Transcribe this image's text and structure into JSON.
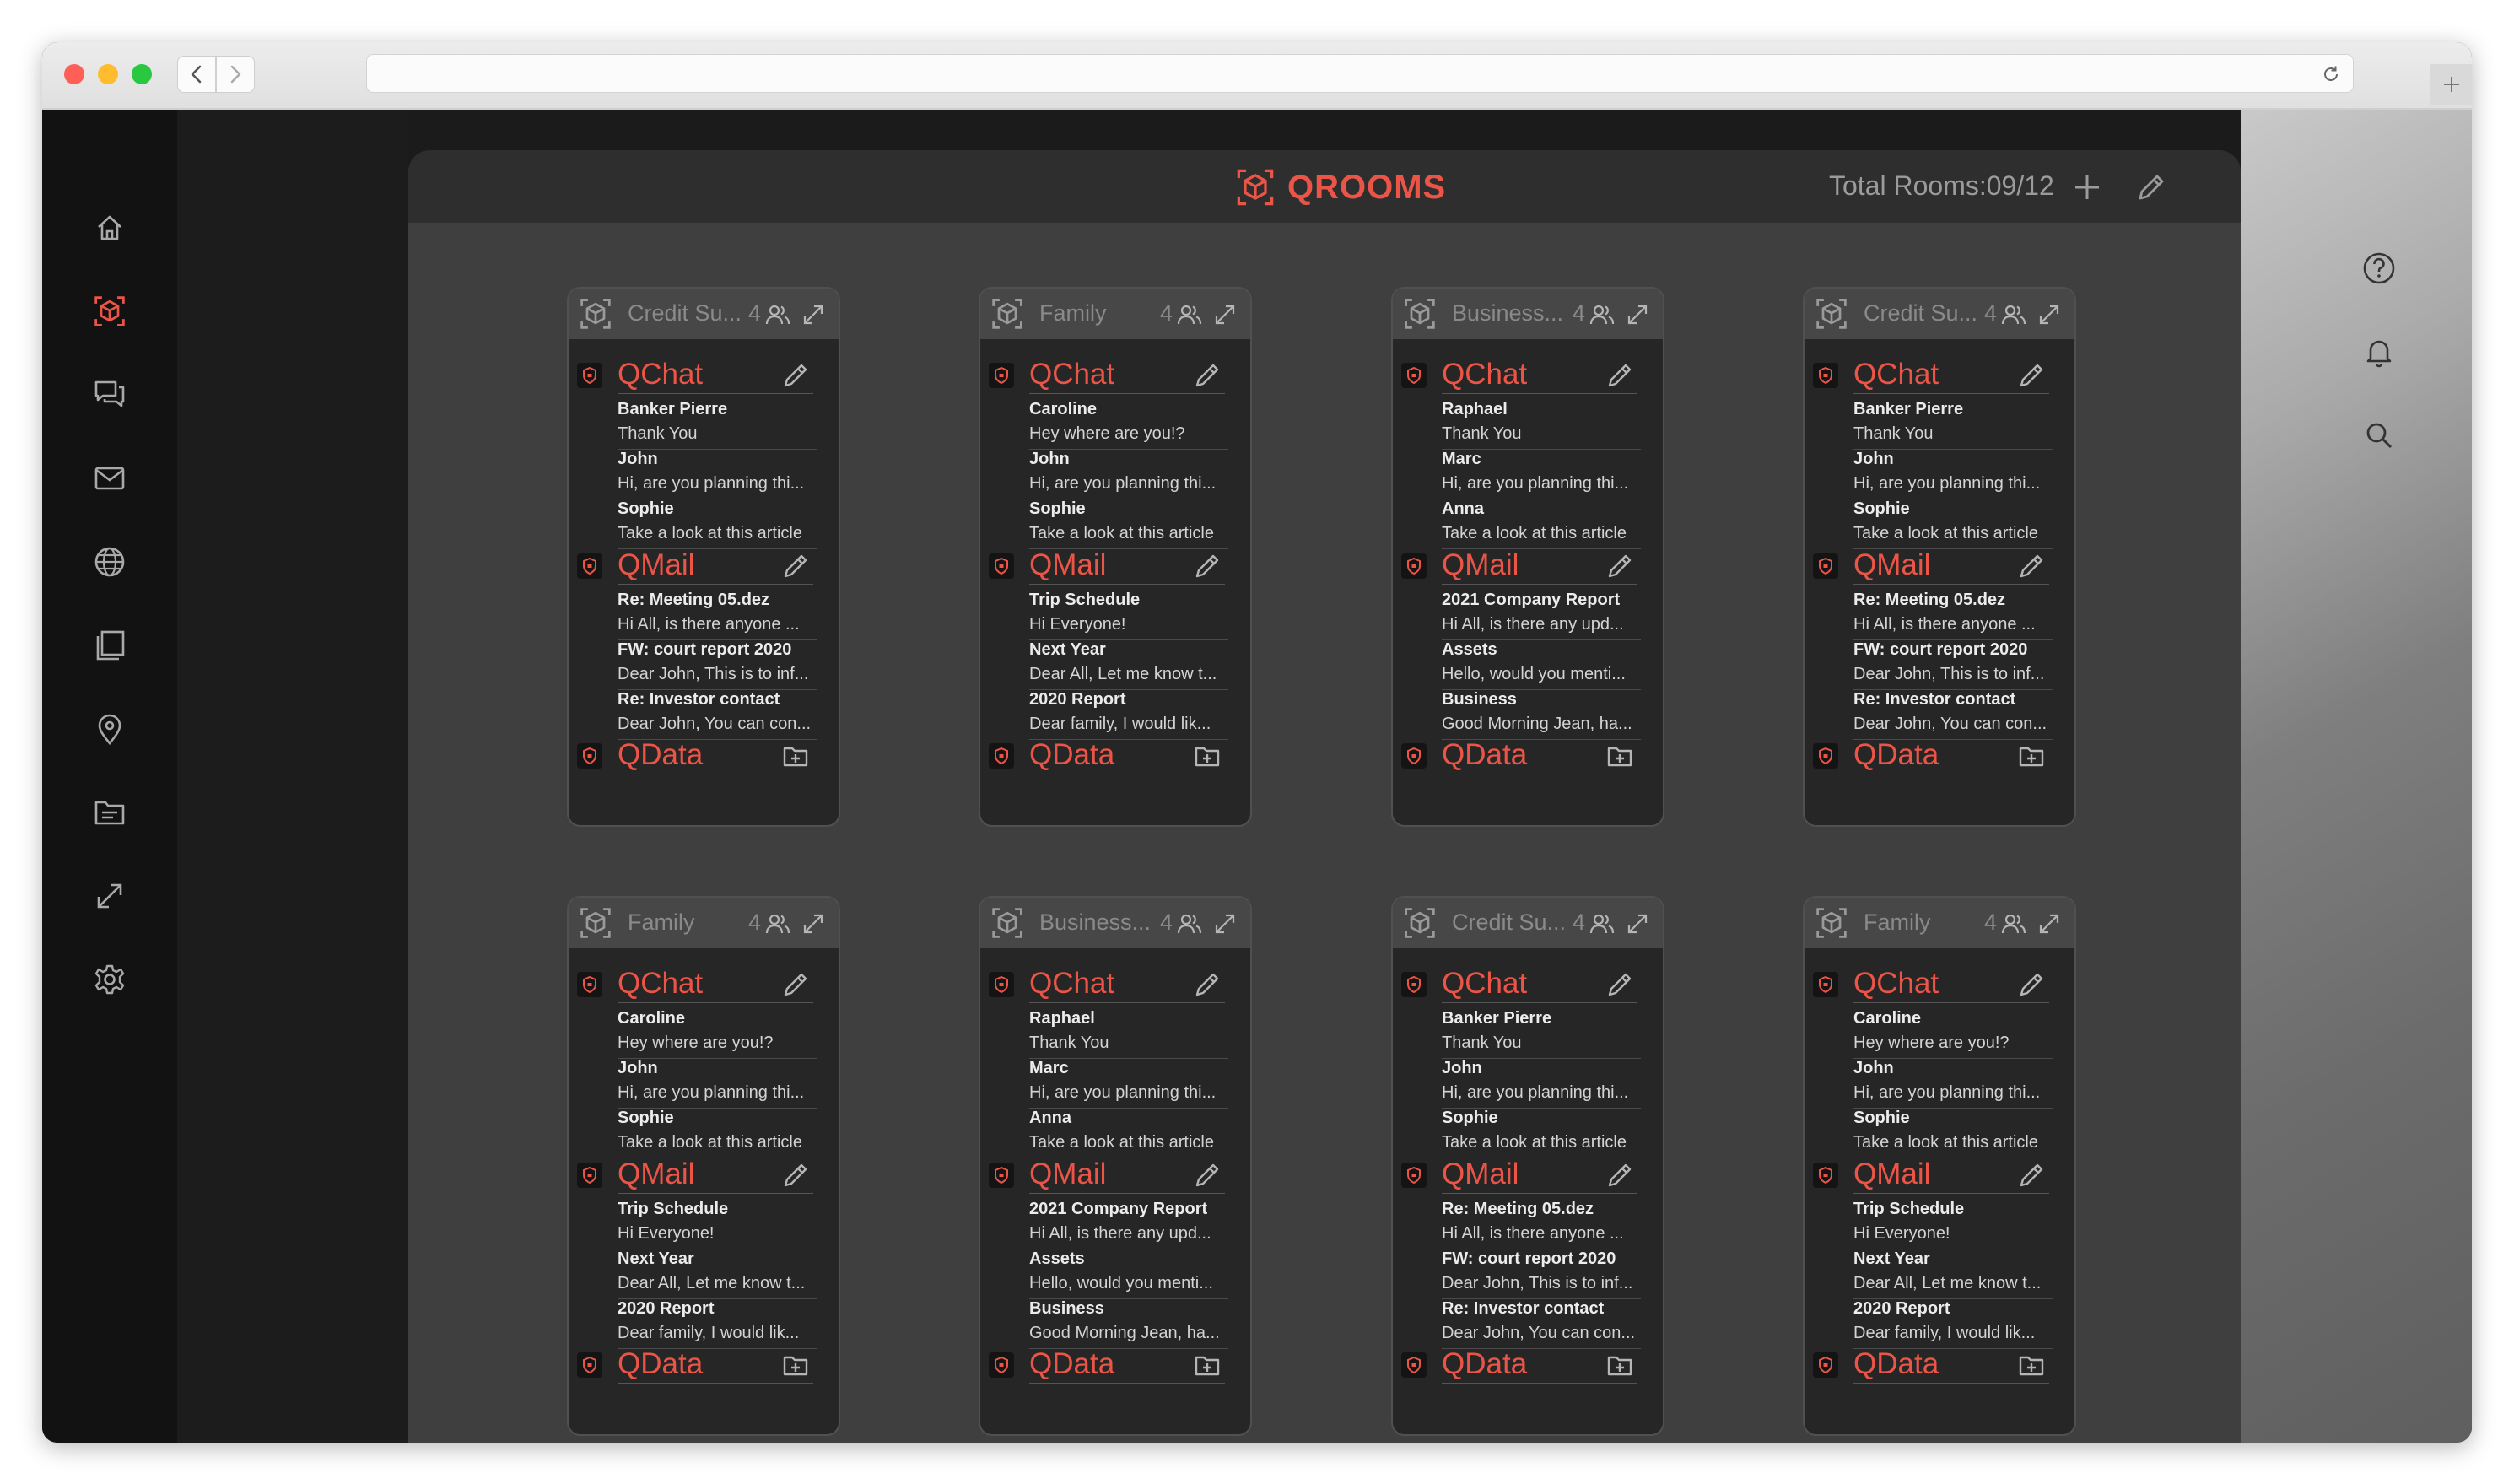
{
  "app": {
    "brand": "QROOMS",
    "total_rooms_label": "Total Rooms:09/12",
    "accent": "#ea5547",
    "icon_color": "#a9a9a9"
  },
  "sidebar": {
    "items": [
      {
        "icon": "home-icon"
      },
      {
        "icon": "rooms-cube-icon",
        "active": true
      },
      {
        "icon": "chat-bubbles-icon"
      },
      {
        "icon": "mail-icon"
      },
      {
        "icon": "globe-icon"
      },
      {
        "icon": "pages-icon"
      },
      {
        "icon": "location-pin-icon"
      },
      {
        "icon": "folder-icon"
      },
      {
        "icon": "expand-arrow-icon"
      },
      {
        "icon": "settings-gear-icon"
      }
    ]
  },
  "right_toolbar": {
    "items": [
      {
        "icon": "help-icon"
      },
      {
        "icon": "bell-icon"
      },
      {
        "icon": "search-icon"
      }
    ]
  },
  "sections": {
    "chat": "QChat",
    "mail": "QMail",
    "data": "QData"
  },
  "rooms": [
    {
      "title": "Credit Su...",
      "count": "4",
      "chat": [
        {
          "who": "Banker Pierre",
          "text": "Thank You"
        },
        {
          "who": "John",
          "text": "Hi, are you planning thi..."
        },
        {
          "who": "Sophie",
          "text": "Take a look at this article"
        }
      ],
      "mail": [
        {
          "who": "Re: Meeting 05.dez",
          "text": "Hi All, is there anyone ..."
        },
        {
          "who": "FW: court report 2020",
          "text": "Dear John, This is to inf..."
        },
        {
          "who": "Re: Investor contact",
          "text": "Dear John, You can con..."
        }
      ]
    },
    {
      "title": "Family",
      "count": "4",
      "chat": [
        {
          "who": "Caroline",
          "text": "Hey where are you!?"
        },
        {
          "who": "John",
          "text": "Hi, are you planning thi..."
        },
        {
          "who": "Sophie",
          "text": "Take a look at this article"
        }
      ],
      "mail": [
        {
          "who": "Trip Schedule",
          "text": "Hi Everyone!"
        },
        {
          "who": "Next Year",
          "text": "Dear All, Let me know t..."
        },
        {
          "who": "2020 Report",
          "text": "Dear family, I would lik..."
        }
      ]
    },
    {
      "title": "Business...",
      "count": "4",
      "chat": [
        {
          "who": "Raphael",
          "text": "Thank You"
        },
        {
          "who": "Marc",
          "text": "Hi, are you planning thi..."
        },
        {
          "who": "Anna",
          "text": "Take a look at this article"
        }
      ],
      "mail": [
        {
          "who": "2021 Company Report",
          "text": "Hi All, is there any upd..."
        },
        {
          "who": "Assets",
          "text": "Hello, would you menti..."
        },
        {
          "who": "Business",
          "text": "Good Morning Jean, ha..."
        }
      ]
    },
    {
      "title": "Credit Su...",
      "count": "4",
      "chat": [
        {
          "who": "Banker Pierre",
          "text": "Thank You"
        },
        {
          "who": "John",
          "text": "Hi, are you planning thi..."
        },
        {
          "who": "Sophie",
          "text": "Take a look at this article"
        }
      ],
      "mail": [
        {
          "who": "Re: Meeting 05.dez",
          "text": "Hi All, is there anyone ..."
        },
        {
          "who": "FW: court report 2020",
          "text": "Dear John, This is to inf..."
        },
        {
          "who": "Re: Investor contact",
          "text": "Dear John, You can con..."
        }
      ]
    },
    {
      "title": "Family",
      "count": "4",
      "chat": [
        {
          "who": "Caroline",
          "text": "Hey where are you!?"
        },
        {
          "who": "John",
          "text": "Hi, are you planning thi..."
        },
        {
          "who": "Sophie",
          "text": "Take a look at this article"
        }
      ],
      "mail": [
        {
          "who": "Trip Schedule",
          "text": "Hi Everyone!"
        },
        {
          "who": "Next Year",
          "text": "Dear All, Let me know t..."
        },
        {
          "who": "2020 Report",
          "text": "Dear family, I would lik..."
        }
      ]
    },
    {
      "title": "Business...",
      "count": "4",
      "chat": [
        {
          "who": "Raphael",
          "text": "Thank You"
        },
        {
          "who": "Marc",
          "text": "Hi, are you planning thi..."
        },
        {
          "who": "Anna",
          "text": "Take a look at this article"
        }
      ],
      "mail": [
        {
          "who": "2021 Company Report",
          "text": "Hi All, is there any upd..."
        },
        {
          "who": "Assets",
          "text": "Hello, would you menti..."
        },
        {
          "who": "Business",
          "text": "Good Morning Jean, ha..."
        }
      ]
    },
    {
      "title": "Credit Su...",
      "count": "4",
      "chat": [
        {
          "who": "Banker Pierre",
          "text": "Thank You"
        },
        {
          "who": "John",
          "text": "Hi, are you planning thi..."
        },
        {
          "who": "Sophie",
          "text": "Take a look at this article"
        }
      ],
      "mail": [
        {
          "who": "Re: Meeting 05.dez",
          "text": "Hi All, is there anyone ..."
        },
        {
          "who": "FW: court report 2020",
          "text": "Dear John, This is to inf..."
        },
        {
          "who": "Re: Investor contact",
          "text": "Dear John, You can con..."
        }
      ]
    },
    {
      "title": "Family",
      "count": "4",
      "chat": [
        {
          "who": "Caroline",
          "text": "Hey where are you!?"
        },
        {
          "who": "John",
          "text": "Hi, are you planning thi..."
        },
        {
          "who": "Sophie",
          "text": "Take a look at this article"
        }
      ],
      "mail": [
        {
          "who": "Trip Schedule",
          "text": "Hi Everyone!"
        },
        {
          "who": "Next Year",
          "text": "Dear All, Let me know t..."
        },
        {
          "who": "2020 Report",
          "text": "Dear family, I would lik..."
        }
      ]
    }
  ]
}
